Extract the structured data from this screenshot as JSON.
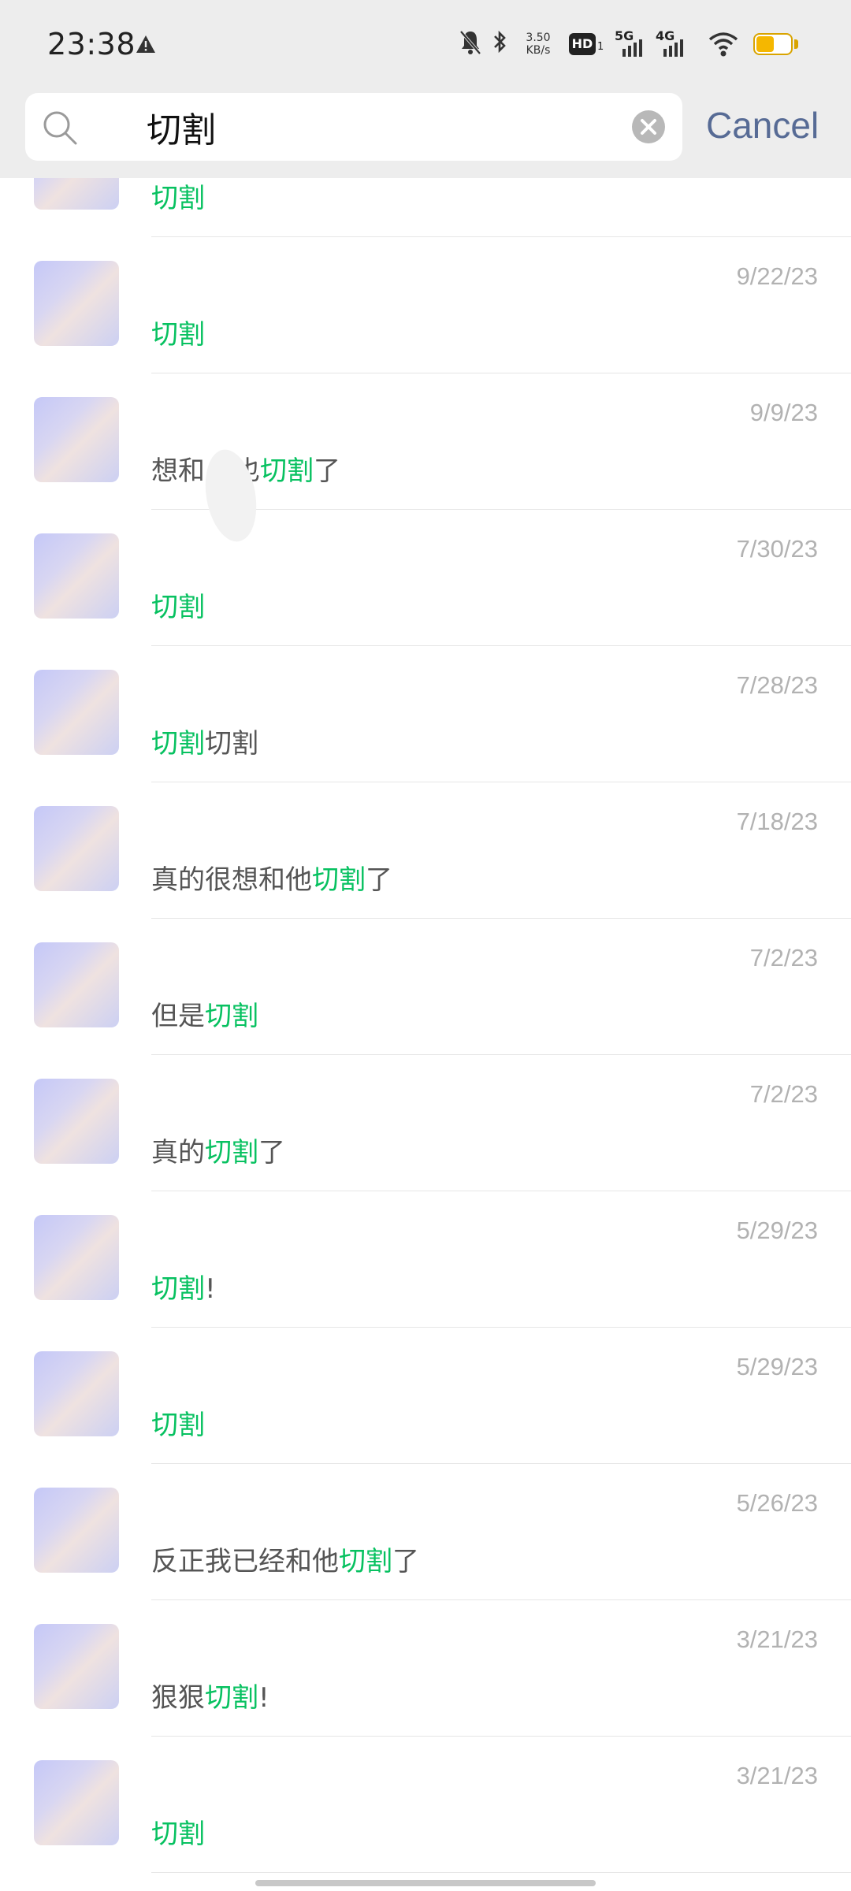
{
  "status_bar": {
    "time": "23:38",
    "net_speed_value": "3.50",
    "net_speed_unit": "KB/s",
    "hd_label": "HD",
    "hd_sub": "1",
    "net1": "5G",
    "net2": "4G",
    "battery_color": "#f5b700"
  },
  "search": {
    "query": "切割",
    "cancel_label": "Cancel"
  },
  "colors": {
    "highlight": "#07c160",
    "date": "#b2b2b2",
    "cancel": "#576b95"
  },
  "results": [
    {
      "date": "",
      "segments": [
        {
          "text": "切割",
          "hl": true
        }
      ]
    },
    {
      "date": "9/22/23",
      "segments": [
        {
          "text": "切割",
          "hl": true
        }
      ]
    },
    {
      "date": "9/9/23",
      "segments": [
        {
          "text": "想和",
          "hl": false
        },
        {
          "text": "也",
          "hl": false
        },
        {
          "text": "切割",
          "hl": true
        },
        {
          "text": "了",
          "hl": false
        }
      ]
    },
    {
      "date": "7/30/23",
      "segments": [
        {
          "text": "切割",
          "hl": true
        }
      ]
    },
    {
      "date": "7/28/23",
      "segments": [
        {
          "text": "切割",
          "hl": true
        },
        {
          "text": "切割",
          "hl": false
        }
      ]
    },
    {
      "date": "7/18/23",
      "segments": [
        {
          "text": "真的很想和他",
          "hl": false
        },
        {
          "text": "切割",
          "hl": true
        },
        {
          "text": "了",
          "hl": false
        }
      ]
    },
    {
      "date": "7/2/23",
      "segments": [
        {
          "text": "但是",
          "hl": false
        },
        {
          "text": "切割",
          "hl": true
        }
      ]
    },
    {
      "date": "7/2/23",
      "segments": [
        {
          "text": "真的",
          "hl": false
        },
        {
          "text": "切割",
          "hl": true
        },
        {
          "text": "了",
          "hl": false
        }
      ]
    },
    {
      "date": "5/29/23",
      "segments": [
        {
          "text": "切割",
          "hl": true
        },
        {
          "text": "!",
          "hl": false
        }
      ]
    },
    {
      "date": "5/29/23",
      "segments": [
        {
          "text": "切割",
          "hl": true
        }
      ]
    },
    {
      "date": "5/26/23",
      "segments": [
        {
          "text": "反正我已经和他",
          "hl": false
        },
        {
          "text": "切割",
          "hl": true
        },
        {
          "text": "了",
          "hl": false
        }
      ]
    },
    {
      "date": "3/21/23",
      "segments": [
        {
          "text": "狠狠",
          "hl": false
        },
        {
          "text": "切割",
          "hl": true
        },
        {
          "text": "!",
          "hl": false
        }
      ]
    },
    {
      "date": "3/21/23",
      "segments": [
        {
          "text": "切割",
          "hl": true
        }
      ]
    }
  ]
}
